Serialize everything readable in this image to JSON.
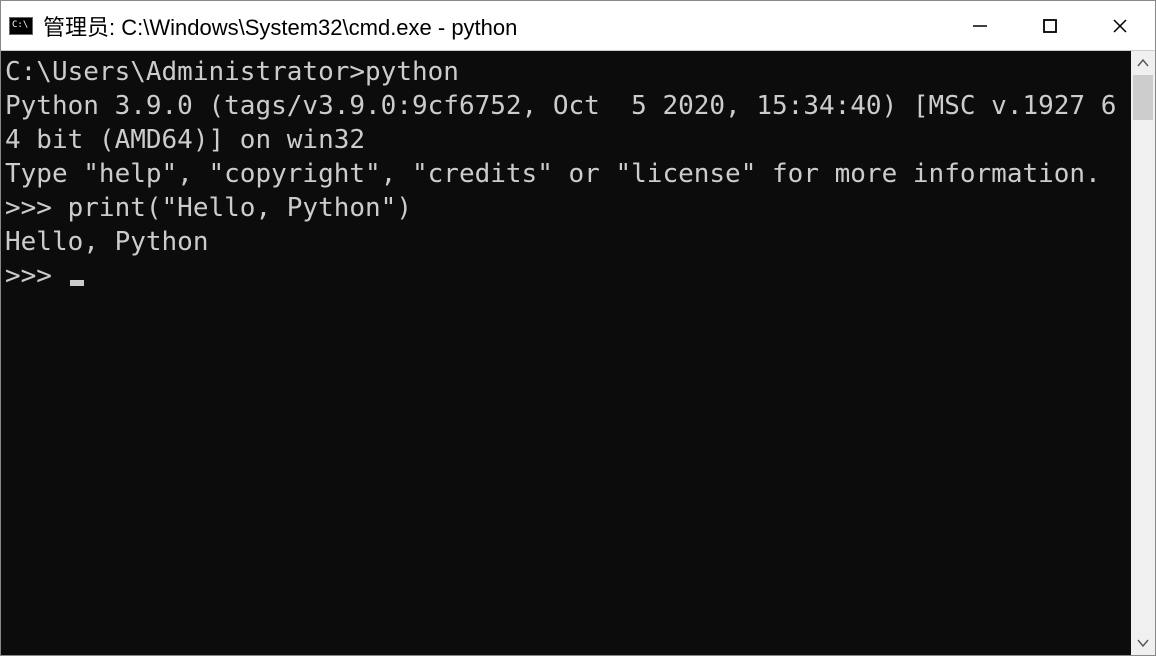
{
  "window": {
    "title": "管理员: C:\\Windows\\System32\\cmd.exe - python"
  },
  "terminal": {
    "blank1": "",
    "line1": "C:\\Users\\Administrator>python",
    "line2": "Python 3.9.0 (tags/v3.9.0:9cf6752, Oct  5 2020, 15:34:40) [MSC v.1927 64 bit (AMD64)] on win32",
    "line3": "Type \"help\", \"copyright\", \"credits\" or \"license\" for more information.",
    "line4": ">>> print(\"Hello, Python\")",
    "line5": "Hello, Python",
    "prompt": ">>> "
  }
}
